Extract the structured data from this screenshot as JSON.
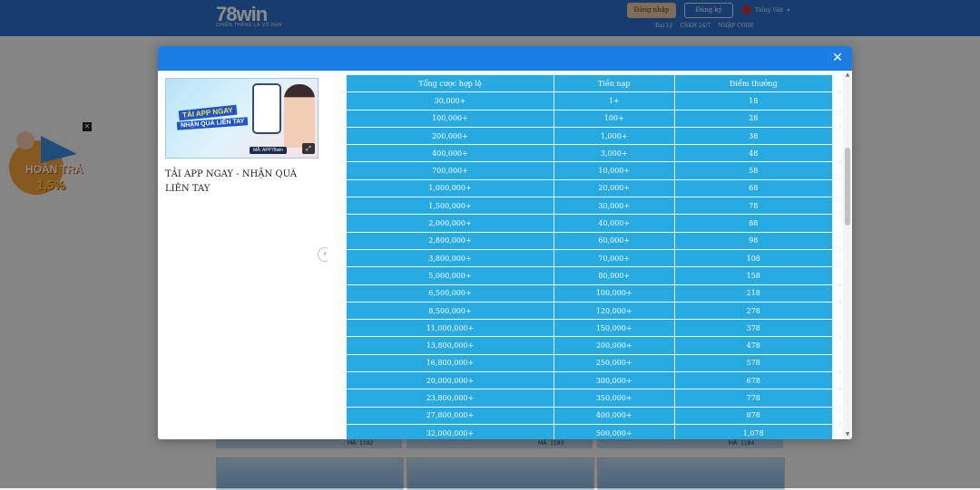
{
  "header": {
    "logo": "78win",
    "logo_sub": "CHIẾN THẮNG LÀ VÔ HẠN",
    "login_label": "Đăng nhập",
    "register_label": "Đăng ký",
    "language": "Tiếng Việt",
    "links": [
      "Đại Lý",
      "CSKH 24/7",
      "NHẬP CODE"
    ]
  },
  "side_promo": {
    "line1": "HOÀN TRẢ",
    "line2": "1,5%"
  },
  "game_strip": [
    "MÃ: 1182",
    "MÃ: 1183",
    "MÃ: 1184"
  ],
  "modal": {
    "banner": {
      "line1": "TẢI APP NGAY",
      "line2": "NHẬN QUÀ LIỀN TAY",
      "code": "MÃ: APP78win"
    },
    "promo_title": "TẢI APP NGAY - NHẬN QUÀ LIÊN TAY",
    "table": {
      "headers": [
        "Tổng cược hợp lệ",
        "Tiền nạp",
        "Điểm thưởng"
      ],
      "rows": [
        [
          "30,000+",
          "1+",
          "18"
        ],
        [
          "100,000+",
          "100+",
          "28"
        ],
        [
          "200,000+",
          "1,000+",
          "38"
        ],
        [
          "400,000+",
          "3,000+",
          "48"
        ],
        [
          "700,000+",
          "10,000+",
          "58"
        ],
        [
          "1,000,000+",
          "20,000+",
          "68"
        ],
        [
          "1,500,000+",
          "30,000+",
          "78"
        ],
        [
          "2,000,000+",
          "40,000+",
          "88"
        ],
        [
          "2,800,000+",
          "60,000+",
          "98"
        ],
        [
          "3,800,000+",
          "70,000+",
          "108"
        ],
        [
          "5,000,000+",
          "80,000+",
          "158"
        ],
        [
          "6,500,000+",
          "100,000+",
          "218"
        ],
        [
          "8,500,000+",
          "120,000+",
          "278"
        ],
        [
          "11,000,000+",
          "150,000+",
          "378"
        ],
        [
          "13,800,000+",
          "200,000+",
          "478"
        ],
        [
          "16,800,000+",
          "250,000+",
          "578"
        ],
        [
          "20,000,000+",
          "300,000+",
          "678"
        ],
        [
          "23,800,000+",
          "350,000+",
          "778"
        ],
        [
          "27,800,000+",
          "400,000+",
          "878"
        ],
        [
          "32,000,000+",
          "500,000+",
          "1,078"
        ]
      ]
    }
  }
}
